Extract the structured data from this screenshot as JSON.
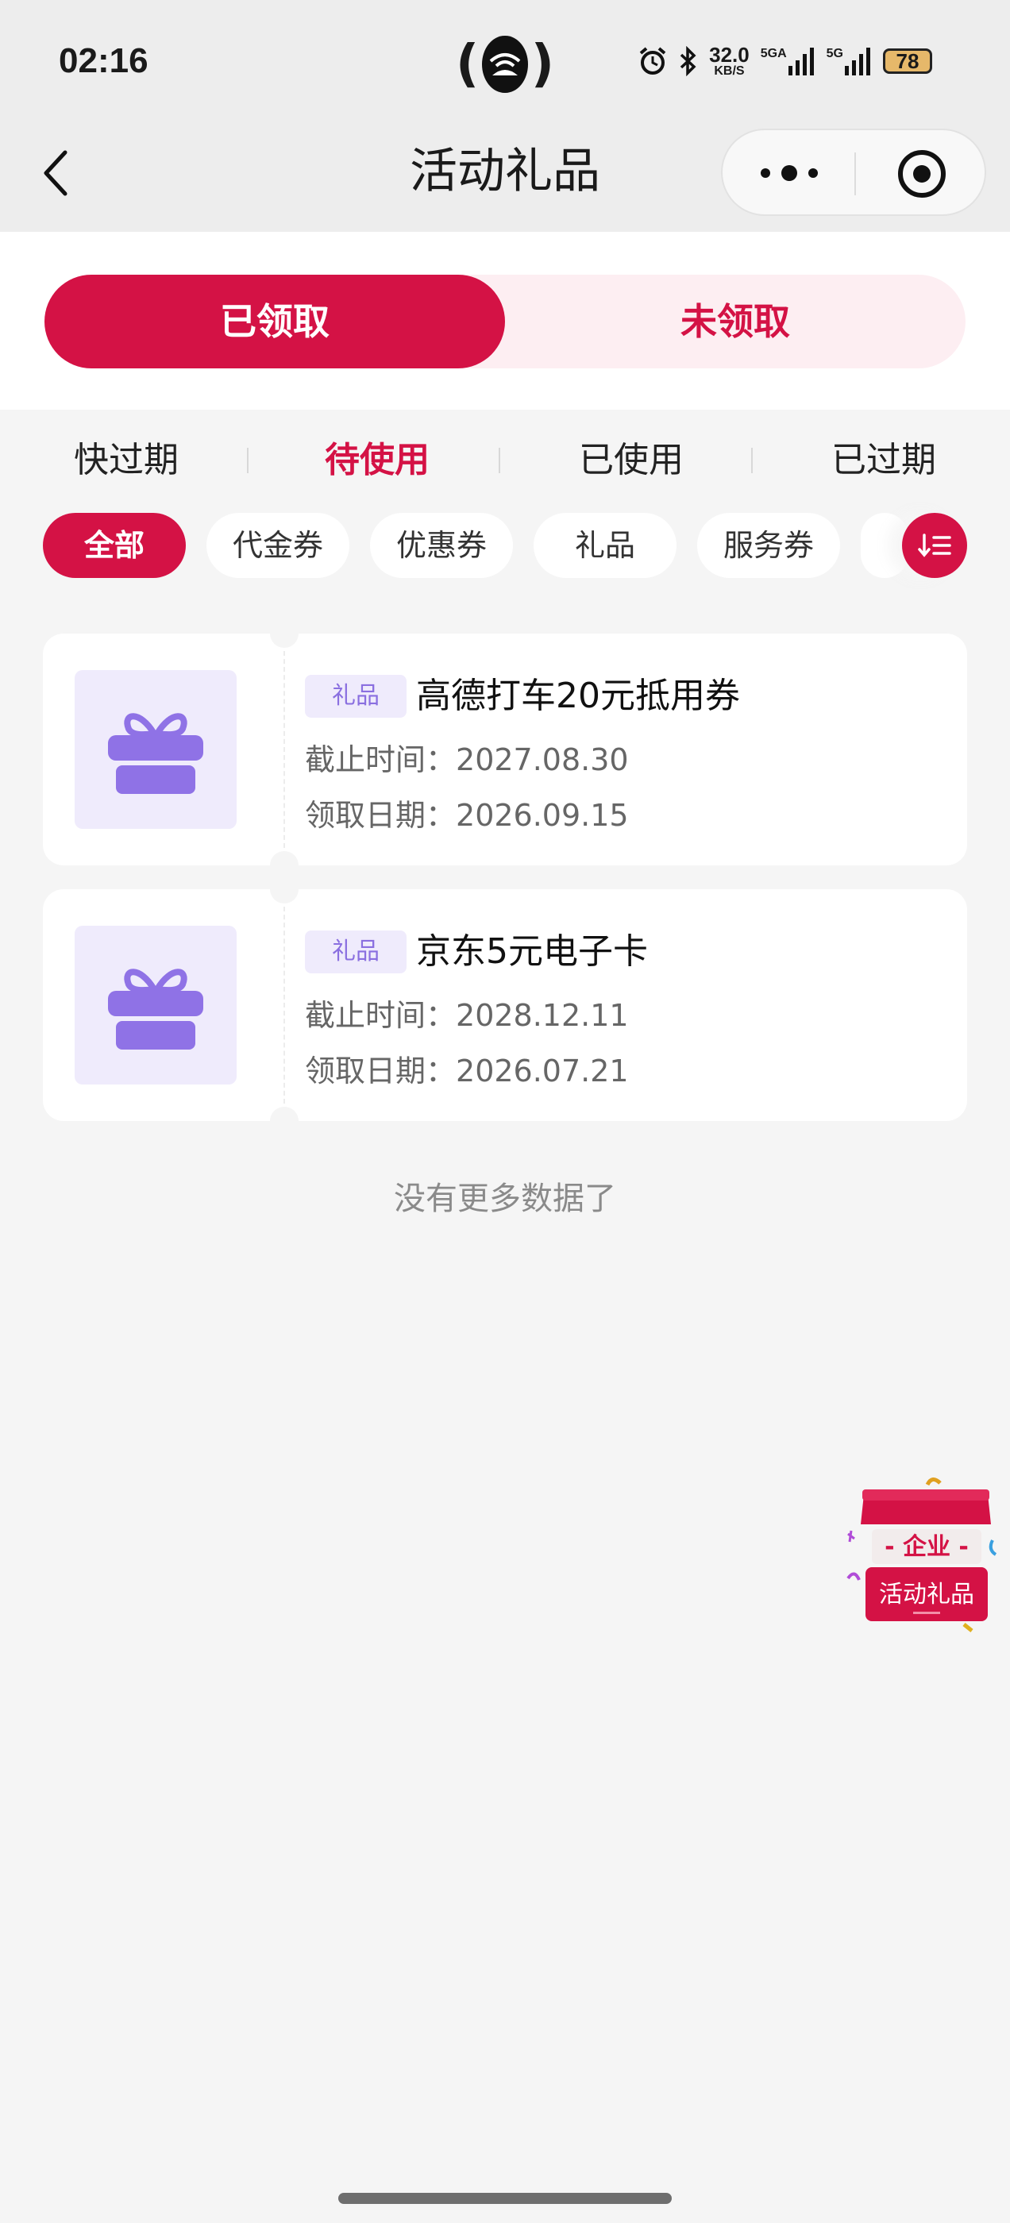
{
  "status_bar": {
    "time": "02:16",
    "net_speed": "32.0",
    "net_unit": "KB/S",
    "sig1_label": "5GA",
    "sig2_label": "5G",
    "battery": "78"
  },
  "nav": {
    "title": "活动礼品",
    "back_icon": "chevron-left-icon",
    "more_icon": "more-dots-icon",
    "target_icon": "target-icon"
  },
  "segment": {
    "active": "已领取",
    "inactive": "未领取"
  },
  "status_tabs": [
    {
      "label": "快过期",
      "active": false
    },
    {
      "label": "待使用",
      "active": true
    },
    {
      "label": "已使用",
      "active": false
    },
    {
      "label": "已过期",
      "active": false
    }
  ],
  "filters": [
    {
      "label": "全部",
      "active": true
    },
    {
      "label": "代金券",
      "active": false
    },
    {
      "label": "优惠券",
      "active": false
    },
    {
      "label": "礼品",
      "active": false
    },
    {
      "label": "服务券",
      "active": false
    }
  ],
  "cards": [
    {
      "tag": "礼品",
      "name": "高德打车20元抵用券",
      "deadline_label": "截止时间：",
      "deadline": "2027.08.30",
      "received_label": "领取日期：",
      "received": "2026.09.15"
    },
    {
      "tag": "礼品",
      "name": "京东5元电子卡",
      "deadline_label": "截止时间：",
      "deadline": "2028.12.11",
      "received_label": "领取日期：",
      "received": "2026.07.21"
    }
  ],
  "footer": {
    "no_more": "没有更多数据了"
  },
  "float_badge": {
    "line1": "- 企业 -",
    "line2": "活动礼品"
  },
  "colors": {
    "brand": "#d41245",
    "brand_light": "#fdeef2",
    "gift_purple": "#8f72e6",
    "gift_bg": "#efebfc"
  }
}
